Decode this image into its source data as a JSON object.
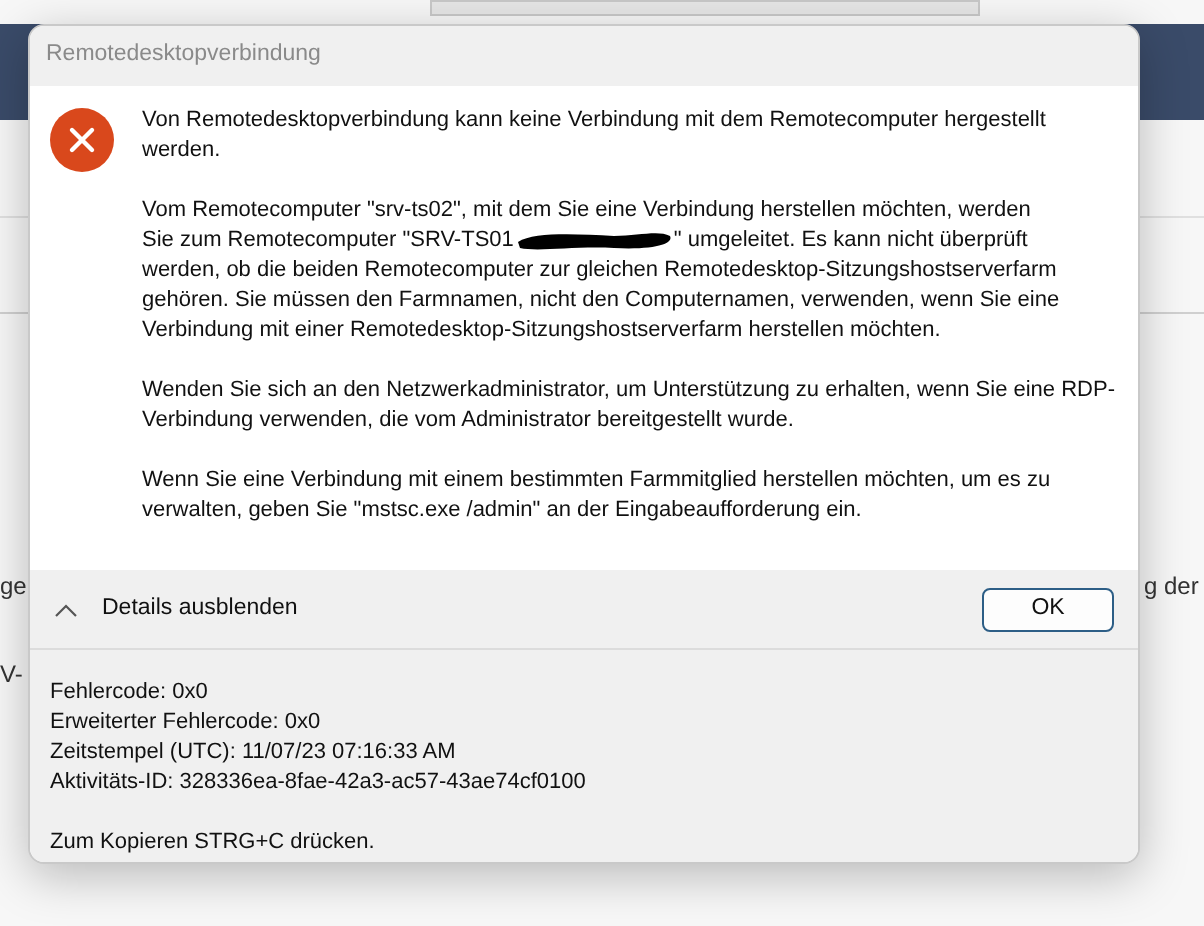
{
  "background": {
    "left_texts": [
      "ge",
      "V-"
    ],
    "right_texts": [
      "g der"
    ]
  },
  "dialog": {
    "title": "Remotedesktopverbindung",
    "message": "Von Remotedesktopverbindung kann keine Verbindung mit dem Remotecomputer hergestellt werden.",
    "redirect_paragraph": {
      "line_1": "Vom Remotecomputer \"srv-ts02\", mit dem Sie eine Verbindung herstellen möchten, werden",
      "line_2_before": "Sie zum Remotecomputer \"SRV-TS01",
      "line_2_after": "\" umgeleitet. Es kann nicht überprüft",
      "rest": "werden, ob die beiden Remotecomputer zur gleichen Remotedesktop-Sitzungshostserverfarm gehören. Sie müssen den Farmnamen, nicht den Computernamen, verwenden, wenn Sie eine Verbindung mit einer Remotedesktop-Sitzungshostserverfarm herstellen möchten."
    },
    "paragraphs": [
      "Wenden Sie sich an den Netzwerkadministrator, um Unterstützung zu erhalten, wenn Sie eine RDP-Verbindung verwenden, die vom Administrator bereitgestellt wurde.",
      "Wenn Sie eine Verbindung mit einem bestimmten Farmmitglied herstellen möchten, um es zu verwalten, geben Sie \"mstsc.exe /admin\" an der Eingabeaufforderung ein."
    ],
    "details_toggle": {
      "label": "Details ausblenden",
      "expanded": true
    },
    "ok_button": "OK",
    "details": [
      "Fehlercode: 0x0",
      "Erweiterter Fehlercode: 0x0",
      "Zeitstempel (UTC): 11/07/23 07:16:33 AM",
      "Aktivitäts-ID: 328336ea-8fae-42a3-ac57-43ae74cf0100"
    ],
    "copy_hint": "Zum Kopieren STRG+C drücken."
  }
}
